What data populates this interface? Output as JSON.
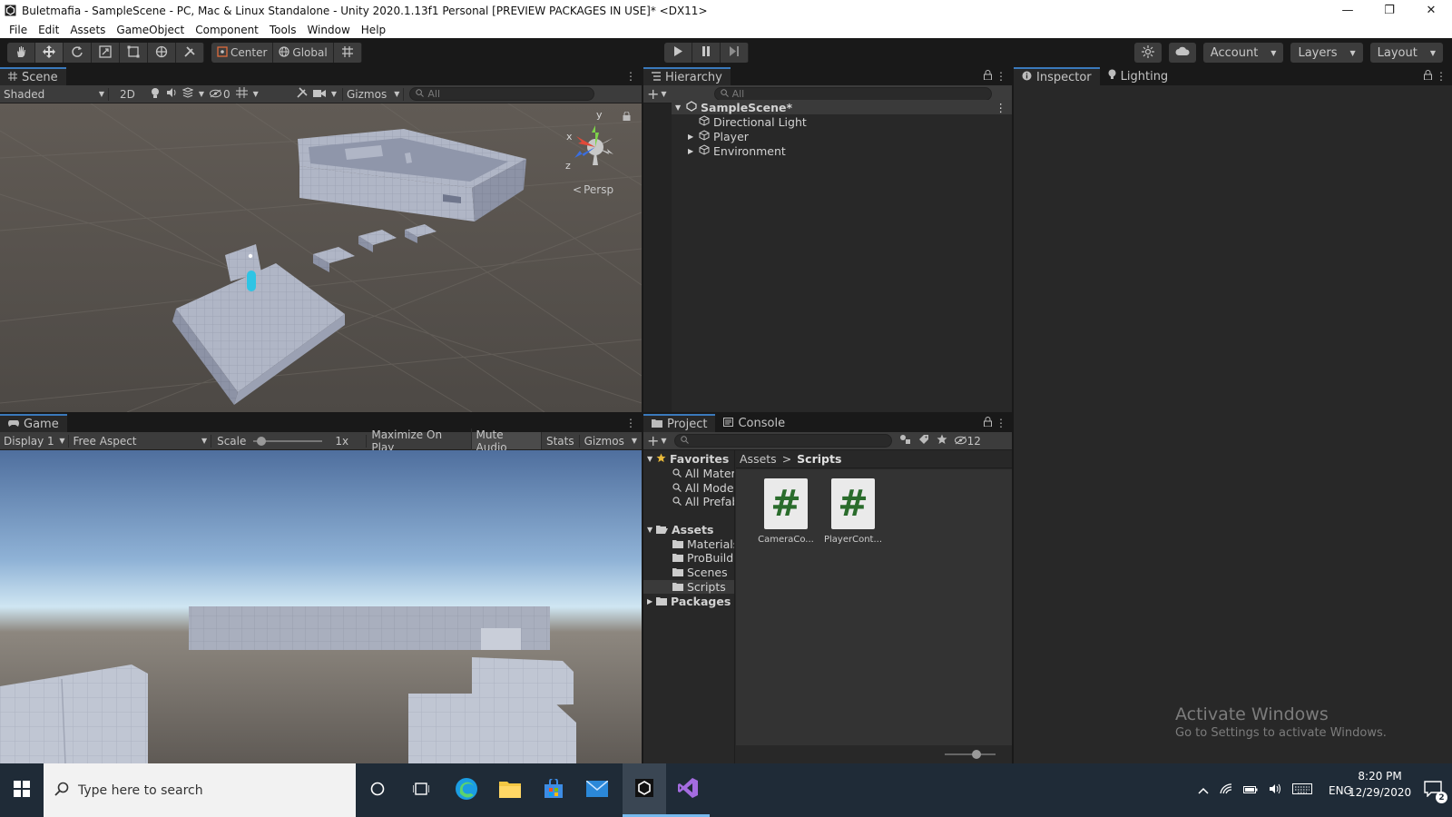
{
  "window": {
    "title": "Buletmafia - SampleScene - PC, Mac & Linux Standalone - Unity 2020.1.13f1 Personal [PREVIEW PACKAGES IN USE]* <DX11>",
    "minimize": "—",
    "maximize": "❐",
    "close": "✕"
  },
  "menu": [
    "File",
    "Edit",
    "Assets",
    "GameObject",
    "Component",
    "Tools",
    "Window",
    "Help"
  ],
  "toolbar": {
    "pivot_label": "Center",
    "space_label": "Global",
    "account_label": "Account",
    "layers_label": "Layers",
    "layout_label": "Layout"
  },
  "scene": {
    "tab_label": "Scene",
    "shading_mode": "Shaded",
    "mode_2d": "2D",
    "hidden_count": "0",
    "gizmos_label": "Gizmos",
    "search_placeholder": "All",
    "projection_label": "Persp",
    "axis_y": "y",
    "axis_x": "x",
    "axis_z": "z"
  },
  "game": {
    "tab_label": "Game",
    "display_label": "Display 1",
    "aspect_label": "Free Aspect",
    "scale_label": "Scale",
    "scale_value": "1x",
    "scale_fraction": 0.05,
    "maximize_label": "Maximize On Play",
    "mute_label": "Mute Audio",
    "stats_label": "Stats",
    "gizmos_label": "Gizmos"
  },
  "hierarchy": {
    "tab_label": "Hierarchy",
    "search_placeholder": "All",
    "scene_name": "SampleScene*",
    "items": [
      {
        "label": "Directional Light",
        "expandable": false
      },
      {
        "label": "Player",
        "expandable": true
      },
      {
        "label": "Environment",
        "expandable": true
      }
    ]
  },
  "inspector": {
    "tab_label": "Inspector",
    "lighting_tab_label": "Lighting"
  },
  "project": {
    "tab_label": "Project",
    "console_tab_label": "Console",
    "hidden_count": "12",
    "favorites_label": "Favorites",
    "favorites": [
      "All Materials",
      "All Models",
      "All Prefabs"
    ],
    "assets_label": "Assets",
    "asset_folders": [
      "Materials",
      "ProBuilder",
      "Scenes",
      "Scripts"
    ],
    "selected_folder": "Scripts",
    "packages_label": "Packages",
    "breadcrumb": [
      "Assets",
      "Scripts"
    ],
    "breadcrumb_sep": ">",
    "files": [
      {
        "name": "CameraCo...",
        "glyph": "#"
      },
      {
        "name": "PlayerCont...",
        "glyph": "#"
      }
    ]
  },
  "watermark": {
    "line1": "Activate Windows",
    "line2": "Go to Settings to activate Windows."
  },
  "taskbar": {
    "search_placeholder": "Type here to search",
    "language": "ENG",
    "time": "8:20 PM",
    "date": "12/29/2020",
    "notification_count": "2"
  },
  "colors": {
    "accent": "#3a79bb",
    "panel_bg": "#282828",
    "toolbar_bg": "#3c3c3c",
    "script_icon_green": "#2a6c2c"
  }
}
